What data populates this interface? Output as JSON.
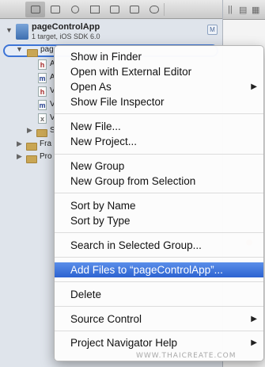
{
  "navigator": {
    "project_name": "pageControlApp",
    "project_subtitle": "1 target, iOS SDK 6.0",
    "project_badge": "M",
    "selected_group_label": "page",
    "files": [
      {
        "icon": "h",
        "type": "header",
        "label": "A"
      },
      {
        "icon": "m",
        "type": "implementation",
        "label": "A"
      },
      {
        "icon": "h",
        "type": "header",
        "label": "V"
      },
      {
        "icon": "m",
        "type": "implementation",
        "label": "V"
      },
      {
        "icon": "x",
        "type": "interface",
        "label": "V"
      }
    ],
    "groups": [
      {
        "label": "S"
      },
      {
        "label": "Fra"
      },
      {
        "label": "Pro"
      }
    ]
  },
  "context_menu": {
    "sections": [
      {
        "items": [
          {
            "label": "Show in Finder"
          },
          {
            "label": "Open with External Editor"
          },
          {
            "label": "Open As",
            "submenu": true
          },
          {
            "label": "Show File Inspector"
          }
        ]
      },
      {
        "items": [
          {
            "label": "New File..."
          },
          {
            "label": "New Project..."
          }
        ]
      },
      {
        "items": [
          {
            "label": "New Group"
          },
          {
            "label": "New Group from Selection"
          }
        ]
      },
      {
        "items": [
          {
            "label": "Sort by Name"
          },
          {
            "label": "Sort by Type"
          }
        ]
      },
      {
        "items": [
          {
            "label": "Search in Selected Group..."
          }
        ]
      },
      {
        "items": [
          {
            "label": "Add Files to “pageControlApp”...",
            "highlighted": true
          }
        ]
      },
      {
        "items": [
          {
            "label": "Delete"
          }
        ]
      },
      {
        "items": [
          {
            "label": "Source Control",
            "submenu": true
          }
        ]
      },
      {
        "items": [
          {
            "label": "Project Navigator Help",
            "submenu": true
          }
        ]
      }
    ],
    "submenu_glyph": "▶"
  },
  "icons": {
    "disclosure_open": "▼",
    "disclosure_closed": "▶",
    "editor_toolbar": [
      "||",
      "▤",
      "▦"
    ]
  },
  "watermark": "WWW.THAICREATE.COM",
  "colors": {
    "selection": "#2c63d1",
    "navigator_bg": "#dfe4eb",
    "folder": "#c9a654"
  }
}
